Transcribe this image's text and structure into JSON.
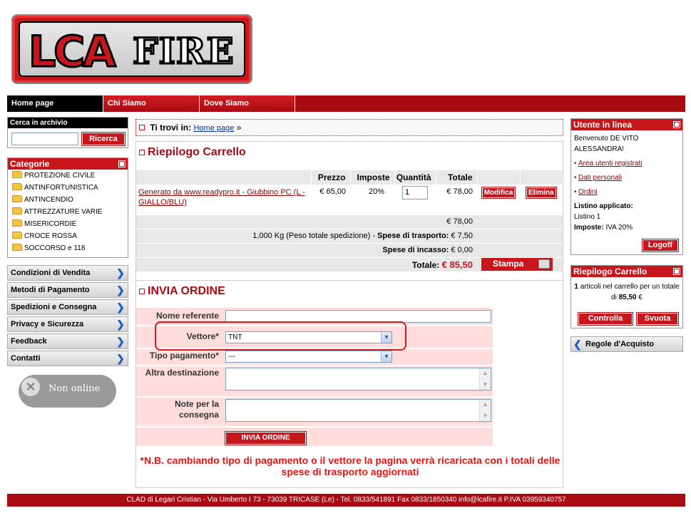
{
  "logo": {
    "part1": "LCA",
    "part2": "FIRE"
  },
  "nav": {
    "home": "Home page",
    "chi": "Chi Siamo",
    "dove": "Dove Siamo"
  },
  "search": {
    "title": "Cerca in archivio",
    "button": "Ricerca",
    "value": ""
  },
  "categories": {
    "title": "Categorie",
    "items": [
      "PROTEZIONE CIVILE",
      "ANTINFORTUNISTICA",
      "ANTINCENDIO",
      "ATTREZZATURE VARIE",
      "MISERICORDIE",
      "CROCE ROSSA",
      "SOCCORSO e 118"
    ]
  },
  "leftmenu": [
    "Condizioni di Vendita",
    "Metodi di Pagamento",
    "Spedizioni e Consegna",
    "Privacy e Sicurezza",
    "Feedback",
    "Contatti"
  ],
  "online_status": "Non online",
  "breadcrumb": {
    "label": "Ti trovi in:",
    "link": "Home page",
    "sep": "»"
  },
  "cart": {
    "title": "Riepilogo Carrello",
    "headers": {
      "prezzo": "Prezzo",
      "imposte": "Imposte",
      "quantita": "Quantità",
      "totale": "Totale"
    },
    "product": {
      "name": "Generato da www.readypro.it - Giubbino PC (L - GIALLO/BLU)",
      "price": "€ 65,00",
      "tax": "20%",
      "qty": "1",
      "total": "€ 78,00",
      "edit": "Modifica",
      "delete": "Elimina"
    },
    "subtotal": "€ 78,00",
    "shipping_weight": "1,000 Kg (Peso totale spedizione)",
    "shipping_label": "Spese di trasporto:",
    "shipping_value": "€ 7,50",
    "cod_label": "Spese di incasso:",
    "cod_value": "€ 0,00",
    "total_label": "Totale:",
    "total_value": "€ 85,50",
    "print": "Stampa"
  },
  "order": {
    "title": "INVIA ORDINE",
    "nome_label": "Nome referente",
    "nome_value": "",
    "vettore_label": "Vettore*",
    "vettore_value": "TNT",
    "pagamento_label": "Tipo pagamento*",
    "pagamento_value": "---",
    "altra_label": "Altra destinazione",
    "note_label": "Note per la consegna",
    "submit": "INVIA ORDINE",
    "notice": "*N.B. cambiando tipo di pagamento o il vettore la pagina verrà ricaricata con i totali delle spese di trasporto aggiornati"
  },
  "user": {
    "title": "Utente in linea",
    "welcome": "Benvenuto DE VITO ALESSANDRA!",
    "links": [
      "Area utenti registrati",
      "Dati personali",
      "Ordini"
    ],
    "listino_label": "Listino applicato:",
    "listino_value": "Listino 1",
    "imposte_label": "Imposte:",
    "imposte_value": "IVA 20%",
    "logoff": "Logoff"
  },
  "cartbox": {
    "title": "Riepilogo Carrello",
    "count": "1",
    "text1": "articoli nel carrello per un totale di",
    "amount": "85,50",
    "currency": "€",
    "controlla": "Controlla",
    "svuota": "Svuota"
  },
  "regole": "Regole d'Acquisto",
  "footer": "CLAD di Legari Cristian - Via Umberto I 73 - 73039 TRICASE (Le) - Tel. 0833/541891 Fax 0833/1850340 info@lcafire.it P.IVA 03959340757"
}
